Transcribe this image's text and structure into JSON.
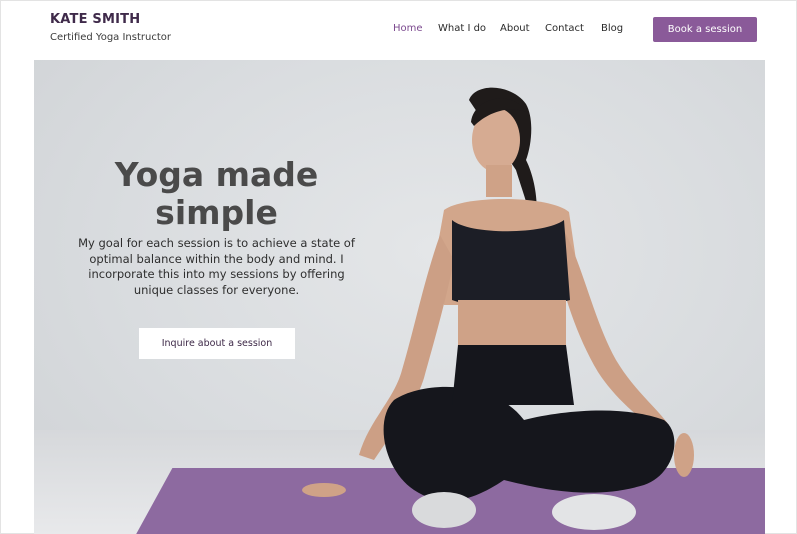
{
  "header": {
    "brand_name": "KATE SMITH",
    "brand_tagline": "Certified Yoga Instructor",
    "nav": [
      "Home",
      "What I do",
      "About",
      "Contact",
      "Blog"
    ],
    "active_nav": "Home",
    "cta_label": "Book a session"
  },
  "hero": {
    "title_line1": "Yoga made",
    "title_line2": "simple",
    "body": "My goal for each session is to achieve a state of optimal balance within the body and mind. I incorporate this into my sessions by offering unique classes for everyone.",
    "cta_label": "Inquire about a session"
  },
  "colors": {
    "accent": "#8a5a99",
    "brand_text": "#3f2a4a",
    "active_nav": "#7c4a8f",
    "mat": "#8d6aa0"
  }
}
